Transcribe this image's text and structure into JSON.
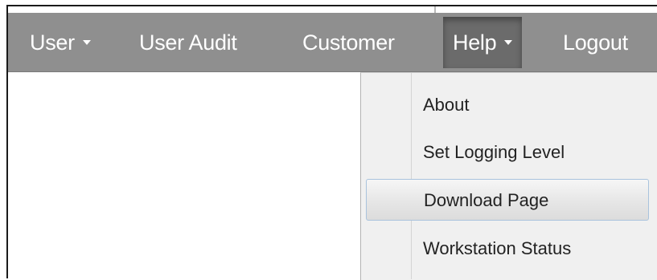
{
  "navbar": {
    "items": [
      {
        "label": "User",
        "has_caret": true
      },
      {
        "label": "User Audit",
        "has_caret": false
      },
      {
        "label": "Customer",
        "has_caret": false
      },
      {
        "label": "Help",
        "has_caret": true,
        "active": true
      },
      {
        "label": "Logout",
        "has_caret": false
      }
    ]
  },
  "help_menu": {
    "items": [
      {
        "label": "About"
      },
      {
        "label": "Set Logging Level"
      },
      {
        "label": "Download Page",
        "hovered": true
      },
      {
        "label": "Workstation Status"
      }
    ]
  },
  "colors": {
    "navbar_bg": "#8f8f8f",
    "active_item_bg": "#6b6b6b",
    "menu_bg": "#f0f0f0",
    "hover_border": "#a9c3dd"
  }
}
